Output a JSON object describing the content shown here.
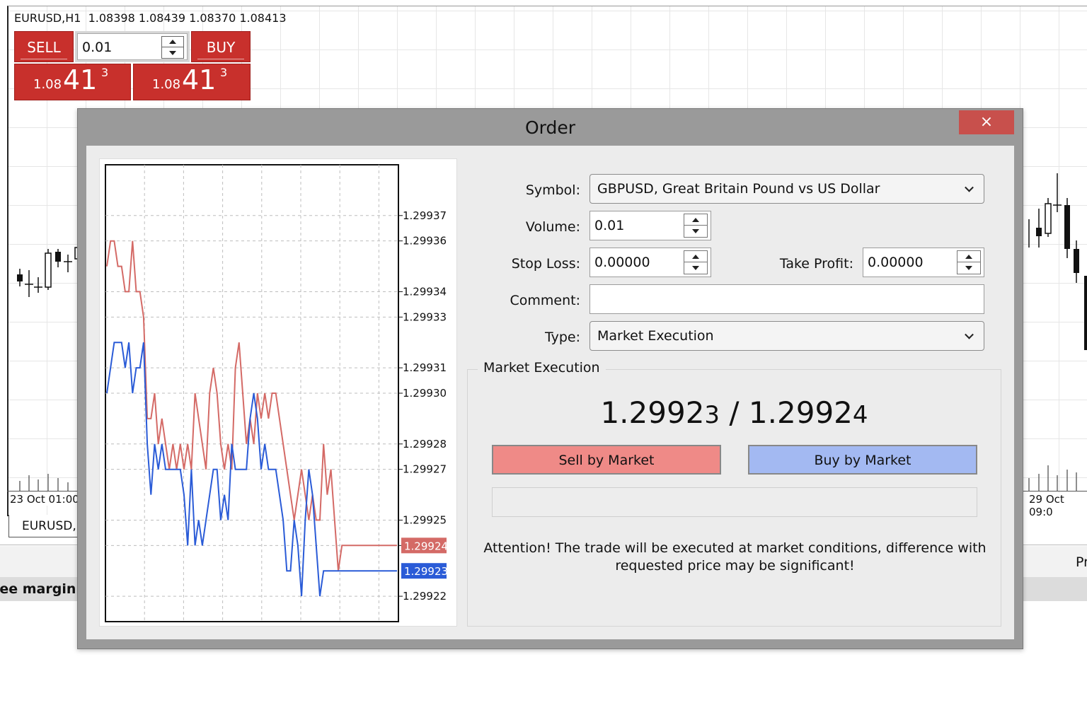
{
  "background": {
    "chart_header": "EURUSD,H1  1.08398 1.08439 1.08370 1.08413",
    "date_left": "23 Oct 01:00",
    "date_right": "29 Oct 09:0",
    "tab_label": "EURUSD,",
    "margin_label": "ree margin:",
    "right_label": "Pr"
  },
  "one_click": {
    "sell_label": "SELL",
    "buy_label": "BUY",
    "volume": "0.01",
    "sell_price": {
      "small": "1.08",
      "big": "41",
      "sup": "3"
    },
    "buy_price": {
      "small": "1.08",
      "big": "41",
      "sup": "3"
    }
  },
  "dialog": {
    "title": "Order",
    "close_icon": "×",
    "colors": {
      "sell": "#ef8a87",
      "buy": "#a3b9f2",
      "bid_line": "#d46a66",
      "ask_line": "#2a5bd7"
    },
    "form": {
      "symbol_label": "Symbol:",
      "symbol_value": "GBPUSD, Great Britain Pound vs US Dollar",
      "volume_label": "Volume:",
      "volume_value": "0.01",
      "stop_loss_label": "Stop Loss:",
      "stop_loss_value": "0.00000",
      "take_profit_label": "Take Profit:",
      "take_profit_value": "0.00000",
      "comment_label": "Comment:",
      "comment_value": "",
      "type_label": "Type:",
      "type_value": "Market Execution"
    },
    "execution": {
      "legend": "Market Execution",
      "bid_main": "1.2992",
      "bid_last": "3",
      "separator": " / ",
      "ask_main": "1.2992",
      "ask_last": "4",
      "sell_button": "Sell by Market",
      "buy_button": "Buy by Market",
      "attention": "Attention! The trade will be executed at market conditions, difference with requested price may be significant!"
    }
  },
  "chart_data": {
    "type": "line",
    "y_ticks": [
      "1.29937",
      "1.29936",
      "1.29934",
      "1.29933",
      "1.29931",
      "1.29930",
      "1.29928",
      "1.29927",
      "1.29925",
      "1.29924",
      "1.29922"
    ],
    "ylim": [
      1.29921,
      1.29939
    ],
    "bid_tag": "1.29924",
    "ask_tag": "1.29923",
    "series": [
      {
        "values": [
          1.29935,
          1.29936,
          1.29936,
          1.29935,
          1.29935,
          1.29934,
          1.29934,
          1.29936,
          1.29934,
          1.29934,
          1.29933,
          1.29929,
          1.29929,
          1.2993,
          1.29928,
          1.29929,
          1.29928,
          1.29927,
          1.29928,
          1.29927,
          1.29928,
          1.29927,
          1.29928,
          1.29927,
          1.2993,
          1.29929,
          1.29928,
          1.29927,
          1.2993,
          1.29931,
          1.2993,
          1.29928,
          1.29927,
          1.29928,
          1.29927,
          1.29931,
          1.29932,
          1.2993,
          1.29928,
          1.29929,
          1.29928,
          1.2993,
          1.29929,
          1.2993,
          1.29929,
          1.2993,
          1.2993,
          1.29929,
          1.29928,
          1.29927,
          1.29926,
          1.29925,
          1.29926,
          1.29927,
          1.29926,
          1.29925,
          1.29926,
          1.29925,
          1.29925,
          1.29928,
          1.29926,
          1.29927,
          1.29925,
          1.29923,
          1.29924,
          1.29924,
          1.29924,
          1.29924,
          1.29924,
          1.29924,
          1.29924,
          1.29924,
          1.29924,
          1.29924,
          1.29924,
          1.29924,
          1.29924,
          1.29924,
          1.29924,
          1.29924
        ]
      },
      {
        "values": [
          1.2993,
          1.29931,
          1.29932,
          1.29932,
          1.29932,
          1.29931,
          1.29932,
          1.2993,
          1.29931,
          1.29931,
          1.29932,
          1.29928,
          1.29926,
          1.29928,
          1.29927,
          1.29928,
          1.29927,
          1.29927,
          1.29927,
          1.29927,
          1.29927,
          1.29926,
          1.29924,
          1.29927,
          1.29924,
          1.29925,
          1.29924,
          1.29925,
          1.29926,
          1.29927,
          1.29927,
          1.29925,
          1.29926,
          1.29925,
          1.29928,
          1.29927,
          1.29927,
          1.29927,
          1.29927,
          1.29929,
          1.2993,
          1.29929,
          1.29927,
          1.29928,
          1.29927,
          1.29927,
          1.29927,
          1.29926,
          1.29925,
          1.29923,
          1.29923,
          1.29925,
          1.29924,
          1.29922,
          1.29925,
          1.29927,
          1.29926,
          1.29924,
          1.29922,
          1.29923,
          1.29923,
          1.29923,
          1.29923,
          1.29923,
          1.29923,
          1.29923,
          1.29923,
          1.29923,
          1.29923,
          1.29923,
          1.29923,
          1.29923,
          1.29923,
          1.29923,
          1.29923,
          1.29923,
          1.29923,
          1.29923,
          1.29923,
          1.29923
        ]
      }
    ]
  }
}
